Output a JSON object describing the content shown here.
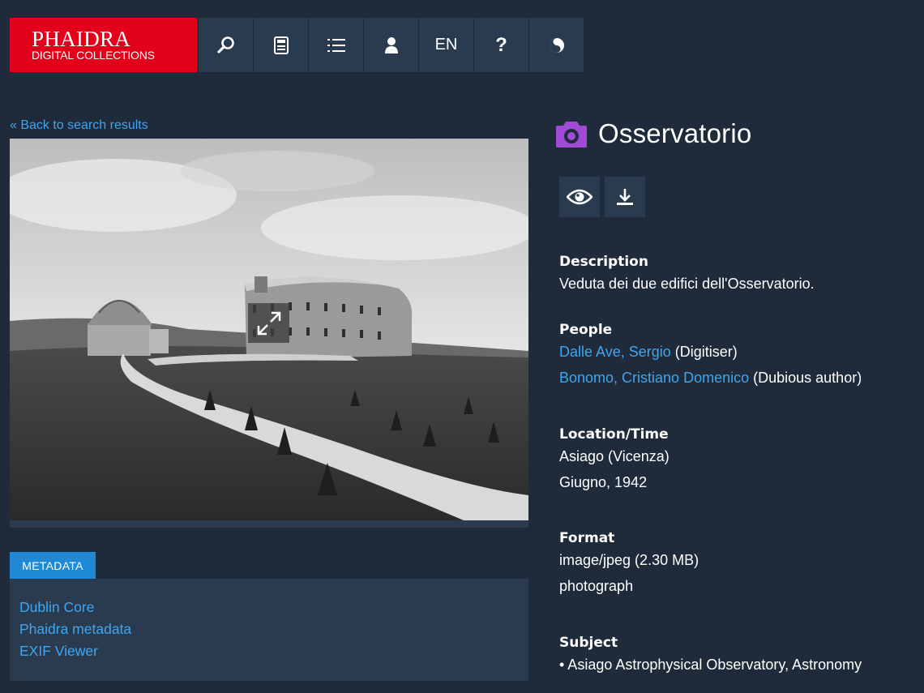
{
  "header": {
    "logo_main": "PHAIDRA",
    "logo_sub": "DIGITAL COLLECTIONS",
    "nav": [
      {
        "icon": "search-icon"
      },
      {
        "icon": "calculator-icon"
      },
      {
        "icon": "list-icon"
      },
      {
        "icon": "user-icon"
      },
      {
        "label": "EN"
      },
      {
        "label": "?"
      },
      {
        "icon": "contrast-icon"
      }
    ]
  },
  "left": {
    "back_link": "« Back to search results",
    "metadata_tab": "METADATA",
    "metadata_links": [
      "Dublin Core",
      "Phaidra metadata",
      "EXIF Viewer"
    ]
  },
  "object": {
    "type_icon": "camera-icon",
    "title": "Osservatorio",
    "actions": [
      {
        "icon": "eye-icon"
      },
      {
        "icon": "download-icon"
      }
    ]
  },
  "details": {
    "description_label": "Description",
    "description": "Veduta dei due edifici dell'Osservatorio.",
    "people_label": "People",
    "people": [
      {
        "name": "Dalle Ave, Sergio",
        "role": "(Digitiser)"
      },
      {
        "name": "Bonomo, Cristiano Domenico",
        "role": "(Dubious author)"
      }
    ],
    "location_label": "Location/Time",
    "location": "Asiago (Vicenza)",
    "time": "Giugno, 1942",
    "format_label": "Format",
    "format_mime": "image/jpeg (2.30 MB)",
    "format_type": "photograph",
    "subject_label": "Subject",
    "subject": "• Asiago Astrophysical Observatory, Astronomy"
  },
  "colors": {
    "background": "#1f2b3a",
    "panel": "#2b3b4f",
    "brand_red": "#e2001a",
    "link": "#3ea6f0",
    "tab_blue": "#1f89d6",
    "camera_purple": "#a04bd6"
  }
}
